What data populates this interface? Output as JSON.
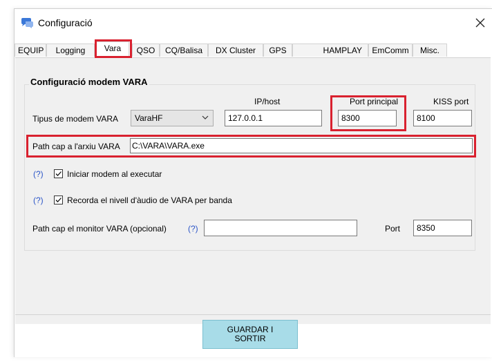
{
  "window": {
    "title": "Configuració",
    "close_glyph": "✕"
  },
  "icons": {
    "app": "chat-bubble-icon",
    "close": "close-icon",
    "combo": "chevron-down-icon",
    "check": "checkmark-icon"
  },
  "colors": {
    "highlight_red": "#d9212f",
    "help_link_blue": "#2b55c8",
    "save_button_bg": "#a8dce8"
  },
  "tabs": [
    {
      "label": "EQUIP"
    },
    {
      "label": "Logging"
    },
    {
      "label": "Vara",
      "active": true
    },
    {
      "label": "QSO"
    },
    {
      "label": "CQ/Balisa"
    },
    {
      "label": "DX Cluster"
    },
    {
      "label": "GPS"
    },
    {
      "label": "HAMPLAY"
    },
    {
      "label": "EmComm"
    },
    {
      "label": "Misc."
    }
  ],
  "group": {
    "title": "Configuració modem VARA",
    "ip_header": "IP/host",
    "port_header": "Port principal",
    "kiss_header": "KISS port",
    "modem_type_label": "Tipus de modem VARA",
    "modem_type_value": "VaraHF",
    "ip_value": "127.0.0.1",
    "port_value": "8300",
    "kiss_value": "8100",
    "path_label": "Path cap a l'arxiu VARA",
    "path_value": "C:\\VARA\\VARA.exe",
    "help": "(?)",
    "start_modem_label": "Iniciar modem al executar",
    "start_modem_checked": true,
    "remember_audio_label": "Recorda el nivell d'àudio de VARA per banda",
    "remember_audio_checked": true,
    "monitor_label": "Path cap el monitor VARA (opcional)",
    "monitor_value": "",
    "monitor_port_label": "Port",
    "monitor_port_value": "8350"
  },
  "footer": {
    "save_line1": "GUARDAR I",
    "save_line2": "SORTIR"
  }
}
